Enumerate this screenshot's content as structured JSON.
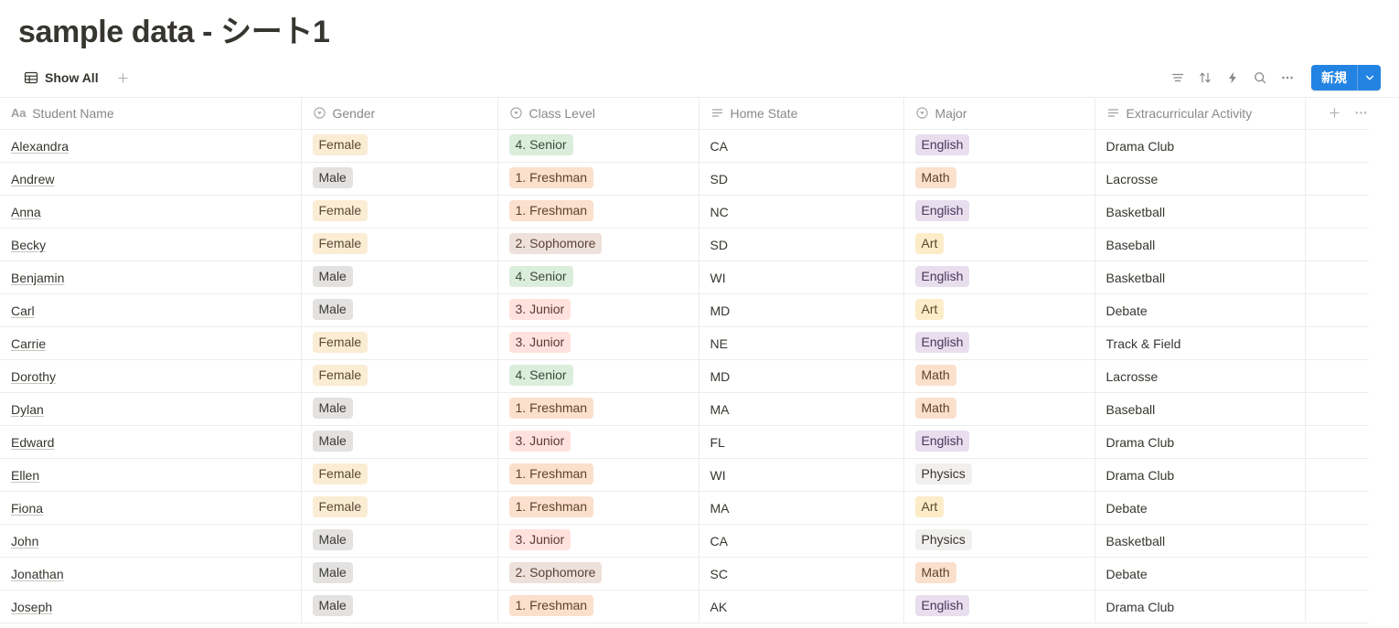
{
  "header": {
    "title": "sample data - シート1"
  },
  "viewbar": {
    "tabs": [
      {
        "label": "Show All",
        "icon": "table-icon",
        "active": true
      }
    ],
    "add_view_label": "+",
    "toolbar": {
      "filter_label": "filter-icon",
      "sort_label": "sort-icon",
      "automation_label": "lightning-icon",
      "search_label": "search-icon",
      "more_label": "more-icon",
      "new_label": "新規",
      "new_caret_label": "chevron-down-icon",
      "accent_color": "#2383e2"
    }
  },
  "table": {
    "columns": [
      {
        "label": "Student Name",
        "type_icon": "title-aa-icon"
      },
      {
        "label": "Gender",
        "type_icon": "select-icon"
      },
      {
        "label": "Class Level",
        "type_icon": "select-icon"
      },
      {
        "label": "Home State",
        "type_icon": "text-icon"
      },
      {
        "label": "Major",
        "type_icon": "select-icon"
      },
      {
        "label": "Extracurricular Activity",
        "type_icon": "text-icon"
      }
    ],
    "add_column_label": "+",
    "column_menu_label": "…",
    "tag_colors": {
      "Female": "#fbecd4",
      "Male": "#e3e2e0",
      "4. Senior": "#dbeddb",
      "1. Freshman": "#fae0cd",
      "2. Sophomore": "#eee0da",
      "3. Junior": "#ffe2dd",
      "English": "#e8deee",
      "Math": "#fae0cd",
      "Art": "#fdecc8",
      "Physics": "#f1f0ef"
    },
    "rows": [
      {
        "name": "Alexandra",
        "gender": "Female",
        "gender_style": "t-orange",
        "level": "4. Senior",
        "level_style": "t-green",
        "state": "CA",
        "major": "English",
        "major_style": "t-purple",
        "activity": "Drama Club"
      },
      {
        "name": "Andrew",
        "gender": "Male",
        "gender_style": "t-gray",
        "level": "1. Freshman",
        "level_style": "t-peach",
        "state": "SD",
        "major": "Math",
        "major_style": "t-peach",
        "activity": "Lacrosse"
      },
      {
        "name": "Anna",
        "gender": "Female",
        "gender_style": "t-orange",
        "level": "1. Freshman",
        "level_style": "t-peach",
        "state": "NC",
        "major": "English",
        "major_style": "t-purple",
        "activity": "Basketball"
      },
      {
        "name": "Becky",
        "gender": "Female",
        "gender_style": "t-orange",
        "level": "2. Sophomore",
        "level_style": "t-brown",
        "state": "SD",
        "major": "Art",
        "major_style": "t-yellow",
        "activity": "Baseball"
      },
      {
        "name": "Benjamin",
        "gender": "Male",
        "gender_style": "t-gray",
        "level": "4. Senior",
        "level_style": "t-green",
        "state": "WI",
        "major": "English",
        "major_style": "t-purple",
        "activity": "Basketball"
      },
      {
        "name": "Carl",
        "gender": "Male",
        "gender_style": "t-gray",
        "level": "3. Junior",
        "level_style": "t-red",
        "state": "MD",
        "major": "Art",
        "major_style": "t-yellow",
        "activity": "Debate"
      },
      {
        "name": "Carrie",
        "gender": "Female",
        "gender_style": "t-orange",
        "level": "3. Junior",
        "level_style": "t-red",
        "state": "NE",
        "major": "English",
        "major_style": "t-purple",
        "activity": "Track & Field"
      },
      {
        "name": "Dorothy",
        "gender": "Female",
        "gender_style": "t-orange",
        "level": "4. Senior",
        "level_style": "t-green",
        "state": "MD",
        "major": "Math",
        "major_style": "t-peach",
        "activity": "Lacrosse"
      },
      {
        "name": "Dylan",
        "gender": "Male",
        "gender_style": "t-gray",
        "level": "1. Freshman",
        "level_style": "t-peach",
        "state": "MA",
        "major": "Math",
        "major_style": "t-peach",
        "activity": "Baseball"
      },
      {
        "name": "Edward",
        "gender": "Male",
        "gender_style": "t-gray",
        "level": "3. Junior",
        "level_style": "t-red",
        "state": "FL",
        "major": "English",
        "major_style": "t-purple",
        "activity": "Drama Club"
      },
      {
        "name": "Ellen",
        "gender": "Female",
        "gender_style": "t-orange",
        "level": "1. Freshman",
        "level_style": "t-peach",
        "state": "WI",
        "major": "Physics",
        "major_style": "t-lgray",
        "activity": "Drama Club"
      },
      {
        "name": "Fiona",
        "gender": "Female",
        "gender_style": "t-orange",
        "level": "1. Freshman",
        "level_style": "t-peach",
        "state": "MA",
        "major": "Art",
        "major_style": "t-yellow",
        "activity": "Debate"
      },
      {
        "name": "John",
        "gender": "Male",
        "gender_style": "t-gray",
        "level": "3. Junior",
        "level_style": "t-red",
        "state": "CA",
        "major": "Physics",
        "major_style": "t-lgray",
        "activity": "Basketball"
      },
      {
        "name": "Jonathan",
        "gender": "Male",
        "gender_style": "t-gray",
        "level": "2. Sophomore",
        "level_style": "t-brown",
        "state": "SC",
        "major": "Math",
        "major_style": "t-peach",
        "activity": "Debate"
      },
      {
        "name": "Joseph",
        "gender": "Male",
        "gender_style": "t-gray",
        "level": "1. Freshman",
        "level_style": "t-peach",
        "state": "AK",
        "major": "English",
        "major_style": "t-purple",
        "activity": "Drama Club"
      }
    ]
  }
}
